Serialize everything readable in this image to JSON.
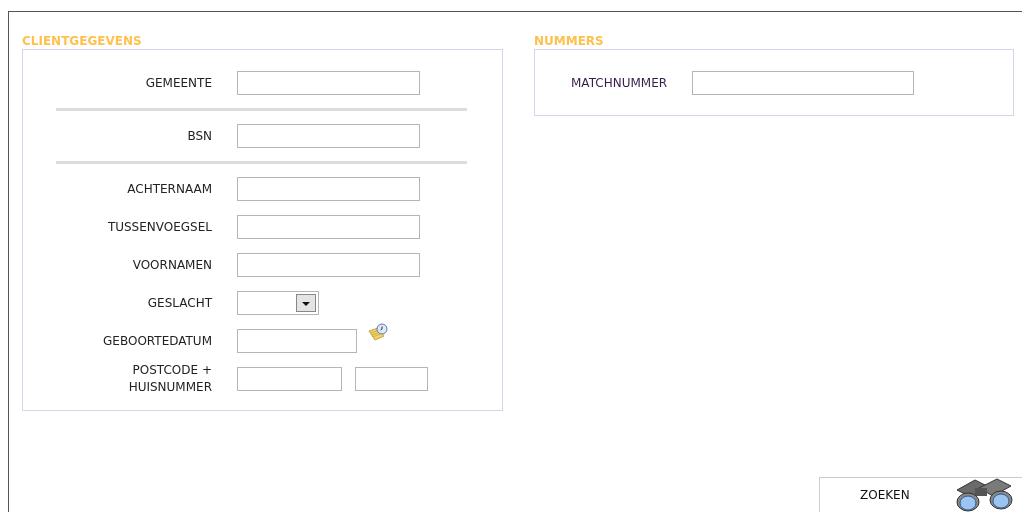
{
  "sections": [
    {
      "title": "CLIENTGEGEVENS",
      "groups": [
        {
          "fields": [
            {
              "kind": "text",
              "label": "GEMEENTE"
            }
          ]
        },
        {
          "fields": [
            {
              "kind": "text",
              "label": "BSN"
            }
          ]
        },
        {
          "fields": [
            {
              "kind": "text",
              "label": "ACHTERNAAM"
            },
            {
              "kind": "text",
              "label": "TUSSENVOEGSEL"
            },
            {
              "kind": "text",
              "label": "VOORNAMEN"
            },
            {
              "kind": "select",
              "label": "GESLACHT"
            },
            {
              "kind": "date",
              "label": "GEBOORTEDATUM"
            },
            {
              "kind": "postcode",
              "label": "POSTCODE +\nHUISNUMMER"
            }
          ]
        }
      ]
    },
    {
      "title": "NUMMERS",
      "groups": [
        {
          "fields": [
            {
              "kind": "wide",
              "label": "MATCHNUMMER"
            }
          ]
        }
      ]
    }
  ],
  "search_button": {
    "label": "ZOEKEN"
  }
}
